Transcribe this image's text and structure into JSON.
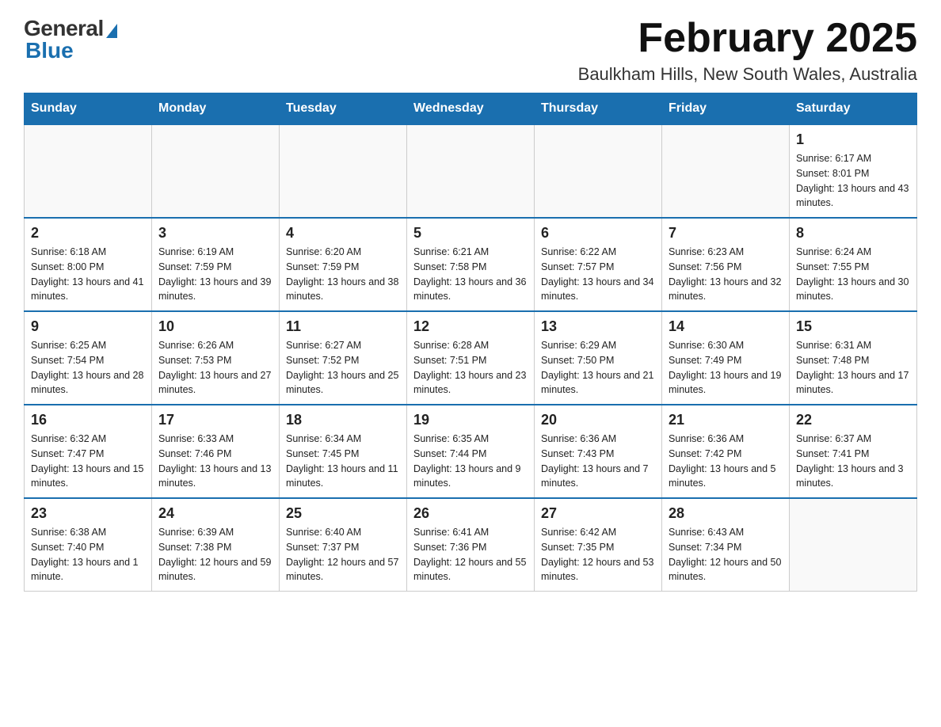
{
  "logo": {
    "general": "General",
    "blue": "Blue"
  },
  "title": "February 2025",
  "location": "Baulkham Hills, New South Wales, Australia",
  "days_of_week": [
    "Sunday",
    "Monday",
    "Tuesday",
    "Wednesday",
    "Thursday",
    "Friday",
    "Saturday"
  ],
  "weeks": [
    [
      {
        "day": "",
        "info": ""
      },
      {
        "day": "",
        "info": ""
      },
      {
        "day": "",
        "info": ""
      },
      {
        "day": "",
        "info": ""
      },
      {
        "day": "",
        "info": ""
      },
      {
        "day": "",
        "info": ""
      },
      {
        "day": "1",
        "info": "Sunrise: 6:17 AM\nSunset: 8:01 PM\nDaylight: 13 hours and 43 minutes."
      }
    ],
    [
      {
        "day": "2",
        "info": "Sunrise: 6:18 AM\nSunset: 8:00 PM\nDaylight: 13 hours and 41 minutes."
      },
      {
        "day": "3",
        "info": "Sunrise: 6:19 AM\nSunset: 7:59 PM\nDaylight: 13 hours and 39 minutes."
      },
      {
        "day": "4",
        "info": "Sunrise: 6:20 AM\nSunset: 7:59 PM\nDaylight: 13 hours and 38 minutes."
      },
      {
        "day": "5",
        "info": "Sunrise: 6:21 AM\nSunset: 7:58 PM\nDaylight: 13 hours and 36 minutes."
      },
      {
        "day": "6",
        "info": "Sunrise: 6:22 AM\nSunset: 7:57 PM\nDaylight: 13 hours and 34 minutes."
      },
      {
        "day": "7",
        "info": "Sunrise: 6:23 AM\nSunset: 7:56 PM\nDaylight: 13 hours and 32 minutes."
      },
      {
        "day": "8",
        "info": "Sunrise: 6:24 AM\nSunset: 7:55 PM\nDaylight: 13 hours and 30 minutes."
      }
    ],
    [
      {
        "day": "9",
        "info": "Sunrise: 6:25 AM\nSunset: 7:54 PM\nDaylight: 13 hours and 28 minutes."
      },
      {
        "day": "10",
        "info": "Sunrise: 6:26 AM\nSunset: 7:53 PM\nDaylight: 13 hours and 27 minutes."
      },
      {
        "day": "11",
        "info": "Sunrise: 6:27 AM\nSunset: 7:52 PM\nDaylight: 13 hours and 25 minutes."
      },
      {
        "day": "12",
        "info": "Sunrise: 6:28 AM\nSunset: 7:51 PM\nDaylight: 13 hours and 23 minutes."
      },
      {
        "day": "13",
        "info": "Sunrise: 6:29 AM\nSunset: 7:50 PM\nDaylight: 13 hours and 21 minutes."
      },
      {
        "day": "14",
        "info": "Sunrise: 6:30 AM\nSunset: 7:49 PM\nDaylight: 13 hours and 19 minutes."
      },
      {
        "day": "15",
        "info": "Sunrise: 6:31 AM\nSunset: 7:48 PM\nDaylight: 13 hours and 17 minutes."
      }
    ],
    [
      {
        "day": "16",
        "info": "Sunrise: 6:32 AM\nSunset: 7:47 PM\nDaylight: 13 hours and 15 minutes."
      },
      {
        "day": "17",
        "info": "Sunrise: 6:33 AM\nSunset: 7:46 PM\nDaylight: 13 hours and 13 minutes."
      },
      {
        "day": "18",
        "info": "Sunrise: 6:34 AM\nSunset: 7:45 PM\nDaylight: 13 hours and 11 minutes."
      },
      {
        "day": "19",
        "info": "Sunrise: 6:35 AM\nSunset: 7:44 PM\nDaylight: 13 hours and 9 minutes."
      },
      {
        "day": "20",
        "info": "Sunrise: 6:36 AM\nSunset: 7:43 PM\nDaylight: 13 hours and 7 minutes."
      },
      {
        "day": "21",
        "info": "Sunrise: 6:36 AM\nSunset: 7:42 PM\nDaylight: 13 hours and 5 minutes."
      },
      {
        "day": "22",
        "info": "Sunrise: 6:37 AM\nSunset: 7:41 PM\nDaylight: 13 hours and 3 minutes."
      }
    ],
    [
      {
        "day": "23",
        "info": "Sunrise: 6:38 AM\nSunset: 7:40 PM\nDaylight: 13 hours and 1 minute."
      },
      {
        "day": "24",
        "info": "Sunrise: 6:39 AM\nSunset: 7:38 PM\nDaylight: 12 hours and 59 minutes."
      },
      {
        "day": "25",
        "info": "Sunrise: 6:40 AM\nSunset: 7:37 PM\nDaylight: 12 hours and 57 minutes."
      },
      {
        "day": "26",
        "info": "Sunrise: 6:41 AM\nSunset: 7:36 PM\nDaylight: 12 hours and 55 minutes."
      },
      {
        "day": "27",
        "info": "Sunrise: 6:42 AM\nSunset: 7:35 PM\nDaylight: 12 hours and 53 minutes."
      },
      {
        "day": "28",
        "info": "Sunrise: 6:43 AM\nSunset: 7:34 PM\nDaylight: 12 hours and 50 minutes."
      },
      {
        "day": "",
        "info": ""
      }
    ]
  ]
}
